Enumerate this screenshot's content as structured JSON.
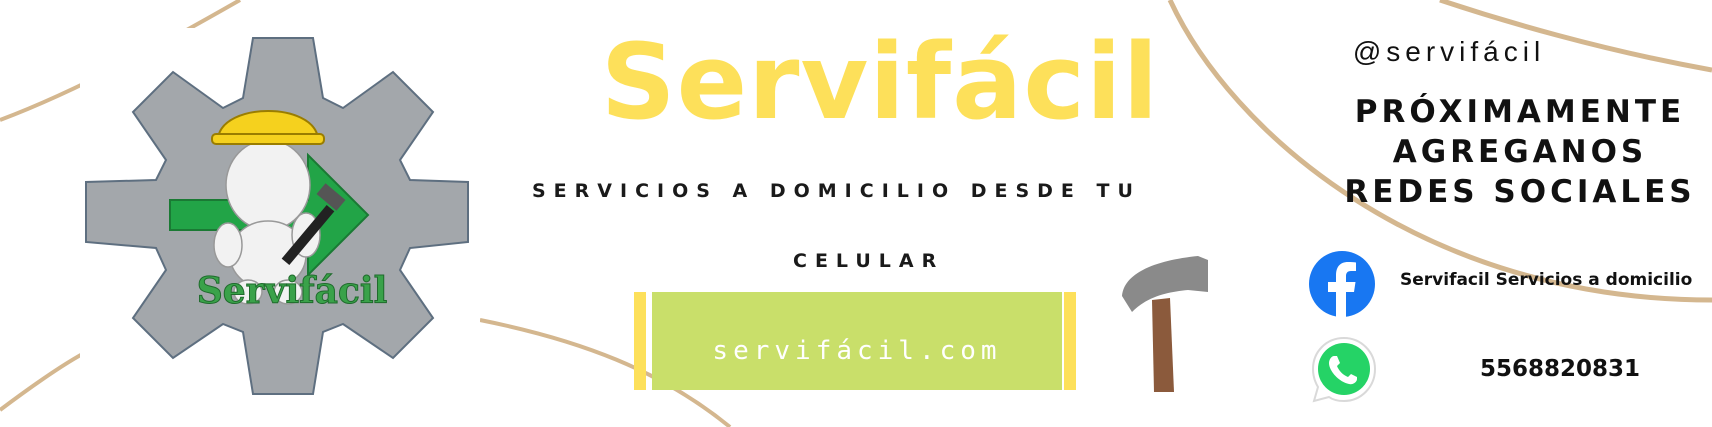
{
  "brand": {
    "title": "Servifácil",
    "logo_caption": "Servifácil"
  },
  "tagline": {
    "line1": "SERVICIOS A DOMICILIO DESDE TU",
    "line2": "CELULAR"
  },
  "website": {
    "text": "servifácil.com"
  },
  "social": {
    "handle": "@servifácil",
    "announcement": [
      "PRÓXIMAMENTE",
      "AGREGANOS",
      "REDES SOCIALES"
    ],
    "facebook_label": "Servifacil Servicios a domicilio",
    "whatsapp_phone": "5568820831"
  },
  "colors": {
    "accent_yellow": "#fde05a",
    "accent_green": "#c9df6a",
    "curve_tan": "#d4b78f",
    "gear_gray": "#a3a7ab",
    "facebook_blue": "#1877f2",
    "whatsapp_green": "#25d366"
  },
  "icons": {
    "logo": "gear-worker-logo-icon",
    "hammer": "hammer-icon",
    "facebook": "facebook-icon",
    "whatsapp": "whatsapp-icon"
  }
}
